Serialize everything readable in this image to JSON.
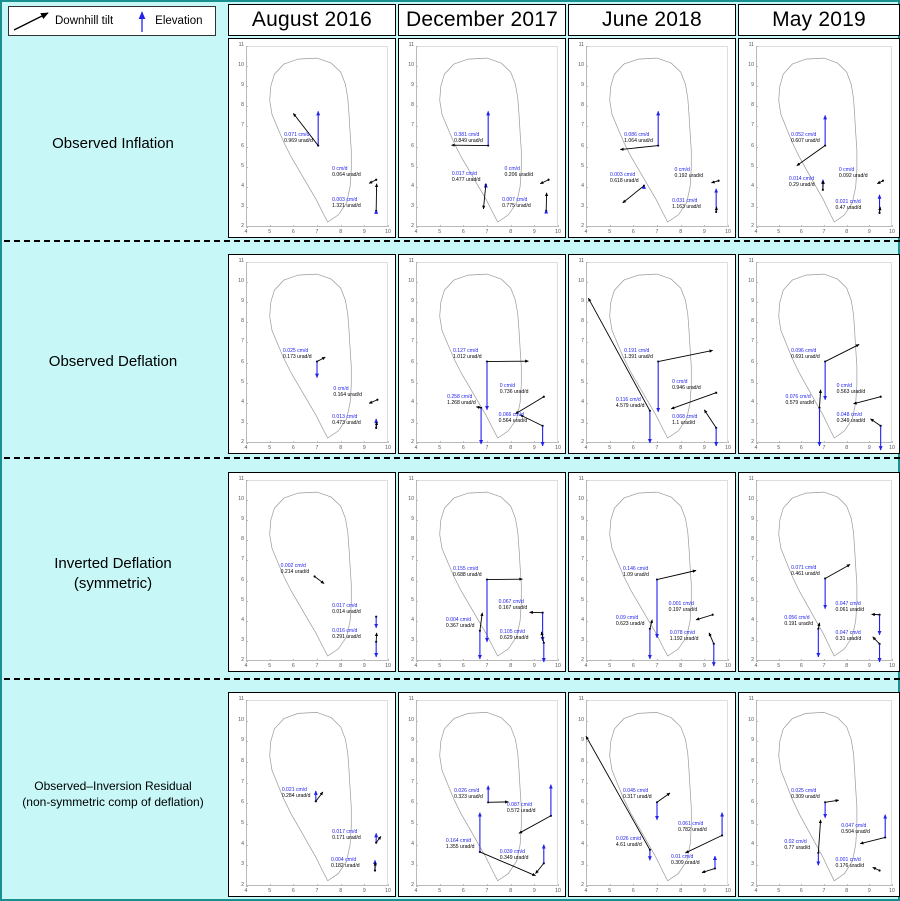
{
  "legend": {
    "tilt_label": "Downhill tilt",
    "elevation_label": "Elevation",
    "tilt_icon": "diagonal-arrow-icon",
    "elevation_icon": "up-arrow-icon",
    "tilt_color": "#000000",
    "elevation_color": "#2222ee"
  },
  "colors": {
    "background": "#c7f7f7",
    "panel": "#ffffff",
    "elevation": "#2222ee",
    "tilt": "#000000",
    "coastline": "#9a9a9a",
    "border": "#1a8f8f"
  },
  "columns": [
    {
      "label": "August 2016"
    },
    {
      "label": "December 2017"
    },
    {
      "label": "June 2018"
    },
    {
      "label": "May 2019"
    }
  ],
  "rows": [
    {
      "line1": "Observed Inflation",
      "line2": ""
    },
    {
      "line1": "Observed Deflation",
      "line2": ""
    },
    {
      "line1": "Inverted Deflation",
      "line2": "(symmetric)"
    },
    {
      "line1": "Observed–Inversion Residual",
      "line2": "(non-symmetric comp of deflation)"
    }
  ],
  "axes": {
    "x_ticks": [
      "4",
      "5",
      "6",
      "7",
      "8",
      "9",
      "10"
    ],
    "y_ticks": [
      "2",
      "3",
      "4",
      "5",
      "6",
      "7",
      "8",
      "9",
      "10",
      "11"
    ],
    "xlim": [
      4,
      10
    ],
    "ylim": [
      2,
      11
    ],
    "units_elevation": "cm/d",
    "units_tilt": "urad/d"
  },
  "chart_data": {
    "type": "scatter",
    "title": "",
    "xlabel": "",
    "ylabel": "",
    "xlim": [
      4,
      10
    ],
    "ylim": [
      2,
      11
    ],
    "grid": false,
    "legend_position": "top-left",
    "series_note": "Each panel shows GPS/tilt station vectors: blue vertical arrow = elevation rate (cm/d), black arrow = downhill tilt direction (urad/d).",
    "panels": [
      {
        "row": "Observed Inflation",
        "column": "August 2016",
        "stations": [
          {
            "x": 7.05,
            "y": 6.05,
            "elevation": "0.071 cm/d",
            "tilt": "0.969 urad/d",
            "elev_dy": 1.7,
            "tilt_dx": -1.05,
            "tilt_dy": 1.6
          },
          {
            "x": 9.5,
            "y": 4.35,
            "elevation": "0 cm/d",
            "tilt": "0.064 urad/d",
            "elev_dy": 0.0,
            "tilt_dx": -0.3,
            "tilt_dy": -0.18
          },
          {
            "x": 9.5,
            "y": 2.8,
            "elevation": "0.003 cm/d",
            "tilt": "1.321 urad/d",
            "elev_dy": 0.05,
            "tilt_dx": 0.02,
            "tilt_dy": 1.35
          }
        ]
      },
      {
        "row": "Observed Inflation",
        "column": "December 2017",
        "stations": [
          {
            "x": 7.05,
            "y": 6.05,
            "elevation": "0.381 cm/d",
            "tilt": "0.849 urad/d",
            "elev_dy": 1.7,
            "tilt_dx": -1.55,
            "tilt_dy": 0.02
          },
          {
            "x": 9.6,
            "y": 4.35,
            "elevation": "0 cm/d",
            "tilt": "0.206 urad/d",
            "elev_dy": 0.0,
            "tilt_dx": -0.35,
            "tilt_dy": -0.2
          },
          {
            "x": 6.95,
            "y": 4.1,
            "elevation": "0.017 cm/d",
            "tilt": "0.477 urad/d",
            "elev_dy": 0.06,
            "tilt_dx": -0.1,
            "tilt_dy": -1.2
          },
          {
            "x": 9.5,
            "y": 2.8,
            "elevation": "0.007 cm/d",
            "tilt": "0.775 urad/d",
            "elev_dy": 0.06,
            "tilt_dx": 0.02,
            "tilt_dy": 0.9
          }
        ]
      },
      {
        "row": "Observed Inflation",
        "column": "June 2018",
        "stations": [
          {
            "x": 7.05,
            "y": 6.05,
            "elevation": "0.086 cm/d",
            "tilt": "1.064 urad/d",
            "elev_dy": 1.7,
            "tilt_dx": -1.6,
            "tilt_dy": -0.2
          },
          {
            "x": 9.6,
            "y": 4.3,
            "elevation": "0 cm/d",
            "tilt": "0.192 urad/d",
            "elev_dy": 0.0,
            "tilt_dx": -0.3,
            "tilt_dy": -0.1
          },
          {
            "x": 6.45,
            "y": 4.05,
            "elevation": "0.003 cm/d",
            "tilt": "0.618 urad/d",
            "elev_dy": 0.04,
            "tilt_dx": -0.9,
            "tilt_dy": -0.85
          },
          {
            "x": 9.5,
            "y": 2.75,
            "elevation": "0.031 cm/d",
            "tilt": "1.163 urad/d",
            "elev_dy": 1.15,
            "tilt_dx": 0.02,
            "tilt_dy": 0.25
          }
        ]
      },
      {
        "row": "Observed Inflation",
        "column": "May 2019",
        "stations": [
          {
            "x": 7.05,
            "y": 6.05,
            "elevation": "0.052 cm/d",
            "tilt": "0.607 urad/d",
            "elev_dy": 1.5,
            "tilt_dx": -1.25,
            "tilt_dy": -1.0
          },
          {
            "x": 9.6,
            "y": 4.3,
            "elevation": "0 cm/d",
            "tilt": "0.092 urad/d",
            "elev_dy": 0.0,
            "tilt_dx": -0.25,
            "tilt_dy": -0.15
          },
          {
            "x": 6.95,
            "y": 3.85,
            "elevation": "0.014 cm/d",
            "tilt": "0.29 urad/d",
            "elev_dy": 0.5,
            "tilt_dx": 0.02,
            "tilt_dy": 0.45
          },
          {
            "x": 9.45,
            "y": 2.7,
            "elevation": "0.021 cm/d",
            "tilt": "0.47 urad/d",
            "elev_dy": 0.9,
            "tilt_dx": 0.03,
            "tilt_dy": 0.3
          }
        ]
      },
      {
        "row": "Observed Deflation",
        "column": "August 2016",
        "stations": [
          {
            "x": 7.0,
            "y": 6.05,
            "elevation": "0.025 cm/d",
            "tilt": "0.173 urad/d",
            "elev_dy": -0.8,
            "tilt_dx": 0.35,
            "tilt_dy": 0.22
          },
          {
            "x": 9.55,
            "y": 4.15,
            "elevation": "0 cm/d",
            "tilt": "0.164 urad/d",
            "elev_dy": 0.0,
            "tilt_dx": -0.35,
            "tilt_dy": -0.18
          },
          {
            "x": 9.5,
            "y": 2.75,
            "elevation": "0.013 cm/d",
            "tilt": "0.473 urad/d",
            "elev_dy": 0.45,
            "tilt_dx": 0.03,
            "tilt_dy": 0.3
          }
        ]
      },
      {
        "row": "Observed Deflation",
        "column": "December 2017",
        "stations": [
          {
            "x": 7.0,
            "y": 6.05,
            "elevation": "0.127 cm/d",
            "tilt": "1.012 urad/d",
            "elev_dy": -2.4,
            "tilt_dx": 1.75,
            "tilt_dy": 0.02
          },
          {
            "x": 9.4,
            "y": 4.3,
            "elevation": "0 cm/d",
            "tilt": "0.736 urad/d",
            "elev_dy": 0.0,
            "tilt_dx": -1.2,
            "tilt_dy": -0.85
          },
          {
            "x": 6.75,
            "y": 3.75,
            "elevation": "0.258 cm/d",
            "tilt": "1.268 urad/d",
            "elev_dy": -1.8,
            "tilt_dx": -0.2,
            "tilt_dy": 0.05
          },
          {
            "x": 9.35,
            "y": 2.85,
            "elevation": "0.066 cm/d",
            "tilt": "0.564 urad/d",
            "elev_dy": -1.0,
            "tilt_dx": -0.95,
            "tilt_dy": 0.55
          }
        ]
      },
      {
        "row": "Observed Deflation",
        "column": "June 2018",
        "stations": [
          {
            "x": 7.05,
            "y": 6.05,
            "elevation": "0.191 cm/d",
            "tilt": "1.391 urad/d",
            "elev_dy": -2.5,
            "tilt_dx": 2.3,
            "tilt_dy": 0.55
          },
          {
            "x": 9.5,
            "y": 4.5,
            "elevation": "0 cm/d",
            "tilt": "0.946 urad/d",
            "elev_dy": 0.0,
            "tilt_dx": -1.9,
            "tilt_dy": -0.8
          },
          {
            "x": 6.7,
            "y": 3.6,
            "elevation": "0.116 cm/d",
            "tilt": "4.579 urad/d",
            "elev_dy": -1.6,
            "tilt_dx": -2.6,
            "tilt_dy": 5.6
          },
          {
            "x": 9.5,
            "y": 2.75,
            "elevation": "0.068 cm/d",
            "tilt": "1.1 urad/d",
            "elev_dy": -0.9,
            "tilt_dx": -0.5,
            "tilt_dy": 0.9
          }
        ]
      },
      {
        "row": "Observed Deflation",
        "column": "May 2019",
        "stations": [
          {
            "x": 7.05,
            "y": 6.05,
            "elevation": "0.096 cm/d",
            "tilt": "0.691 urad/d",
            "elev_dy": -1.9,
            "tilt_dx": 1.5,
            "tilt_dy": 0.85
          },
          {
            "x": 9.5,
            "y": 4.3,
            "elevation": "0 cm/d",
            "tilt": "0.563 urad/d",
            "elev_dy": 0.0,
            "tilt_dx": -1.2,
            "tilt_dy": -0.35
          },
          {
            "x": 6.8,
            "y": 3.75,
            "elevation": "0.076 cm/d",
            "tilt": "0.579 urad/d",
            "elev_dy": -1.9,
            "tilt_dx": 0.05,
            "tilt_dy": 0.9
          },
          {
            "x": 9.5,
            "y": 2.85,
            "elevation": "0.048 cm/d",
            "tilt": "0.349 urad/d",
            "elev_dy": -1.2,
            "tilt_dx": -0.45,
            "tilt_dy": 0.35
          }
        ]
      },
      {
        "row": "Inverted Deflation",
        "column": "August 2016",
        "stations": [
          {
            "x": 6.9,
            "y": 6.2,
            "elevation": "0.002 cm/d",
            "tilt": "0.214 urad/d",
            "elev_dy": 0.0,
            "tilt_dx": 0.4,
            "tilt_dy": -0.35
          },
          {
            "x": 9.5,
            "y": 4.2,
            "elevation": "0.017 cm/d",
            "tilt": "0.014 urad/d",
            "elev_dy": -0.55,
            "tilt_dx": 0.0,
            "tilt_dy": 0.0
          },
          {
            "x": 9.5,
            "y": 2.95,
            "elevation": "0.016 cm/d",
            "tilt": "0.291 urad/d",
            "elev_dy": -0.75,
            "tilt_dx": 0.02,
            "tilt_dy": 0.45
          }
        ]
      },
      {
        "row": "Inverted Deflation",
        "column": "December 2017",
        "stations": [
          {
            "x": 7.0,
            "y": 6.05,
            "elevation": "0.155 cm/d",
            "tilt": "0.688 urad/d",
            "elev_dy": -3.1,
            "tilt_dx": 1.5,
            "tilt_dy": 0.02
          },
          {
            "x": 9.35,
            "y": 4.4,
            "elevation": "0.067 cm/d",
            "tilt": "0.167 urad/d",
            "elev_dy": -1.4,
            "tilt_dx": -0.55,
            "tilt_dy": 0.02
          },
          {
            "x": 6.7,
            "y": 3.5,
            "elevation": "0.004 cm/d",
            "tilt": "0.367 urad/d",
            "elev_dy": -1.4,
            "tilt_dx": 0.1,
            "tilt_dy": 0.9
          },
          {
            "x": 9.4,
            "y": 2.9,
            "elevation": "0.105 cm/d",
            "tilt": "0.629 urad/d",
            "elev_dy": -0.95,
            "tilt_dx": -0.1,
            "tilt_dy": 0.55
          }
        ]
      },
      {
        "row": "Inverted Deflation",
        "column": "June 2018",
        "stations": [
          {
            "x": 7.0,
            "y": 6.05,
            "elevation": "0.146 cm/d",
            "tilt": "1.09 urad/d",
            "elev_dy": -2.9,
            "tilt_dx": 1.65,
            "tilt_dy": 0.45
          },
          {
            "x": 9.35,
            "y": 4.3,
            "elevation": "0.001 cm/d",
            "tilt": "0.197 urad/d",
            "elev_dy": 0.0,
            "tilt_dx": -0.7,
            "tilt_dy": -0.25
          },
          {
            "x": 6.7,
            "y": 3.6,
            "elevation": "0.09 cm/d",
            "tilt": "0.623 urad/d",
            "elev_dy": -1.5,
            "tilt_dx": 0.1,
            "tilt_dy": 0.45
          },
          {
            "x": 9.4,
            "y": 2.85,
            "elevation": "0.078 cm/d",
            "tilt": "1.192 urad/d",
            "elev_dy": -1.1,
            "tilt_dx": -0.2,
            "tilt_dy": 0.55
          }
        ]
      },
      {
        "row": "Inverted Deflation",
        "column": "May 2019",
        "stations": [
          {
            "x": 7.05,
            "y": 6.1,
            "elevation": "0.071 cm/d",
            "tilt": "0.461 urad/d",
            "elev_dy": -1.5,
            "tilt_dx": 1.1,
            "tilt_dy": 0.7
          },
          {
            "x": 9.45,
            "y": 4.3,
            "elevation": "0.047 cm/d",
            "tilt": "0.061 urad/d",
            "elev_dy": -1.0,
            "tilt_dx": -0.35,
            "tilt_dy": 0.02
          },
          {
            "x": 6.75,
            "y": 3.6,
            "elevation": "0.056 cm/d",
            "tilt": "0.191 urad/d",
            "elev_dy": -1.4,
            "tilt_dx": 0.05,
            "tilt_dy": 0.3
          },
          {
            "x": 9.45,
            "y": 2.85,
            "elevation": "0.047 cm/d",
            "tilt": "0.31 urad/d",
            "elev_dy": -0.9,
            "tilt_dx": -0.3,
            "tilt_dy": 0.35
          }
        ]
      },
      {
        "row": "Observed–Inversion Residual",
        "column": "August 2016",
        "stations": [
          {
            "x": 6.95,
            "y": 6.1,
            "elevation": "0.021 cm/d",
            "tilt": "0.284 urad/d",
            "elev_dy": 0.5,
            "tilt_dx": 0.3,
            "tilt_dy": 0.45
          },
          {
            "x": 9.5,
            "y": 4.1,
            "elevation": "0.017 cm/d",
            "tilt": "0.171 urad/d",
            "elev_dy": 0.45,
            "tilt_dx": 0.2,
            "tilt_dy": 0.3
          },
          {
            "x": 9.45,
            "y": 2.75,
            "elevation": "0.004 cm/d",
            "tilt": "0.182 urad/d",
            "elev_dy": 0.5,
            "tilt_dx": 0.02,
            "tilt_dy": 0.4
          }
        ]
      },
      {
        "row": "Observed–Inversion Residual",
        "column": "December 2017",
        "stations": [
          {
            "x": 7.05,
            "y": 6.05,
            "elevation": "0.026 cm/d",
            "tilt": "0.323 urad/d",
            "elev_dy": 0.8,
            "tilt_dx": 0.85,
            "tilt_dy": 0.02
          },
          {
            "x": 9.7,
            "y": 5.4,
            "elevation": "0.087 cm/d",
            "tilt": "0.572 urad/d",
            "elev_dy": 1.5,
            "tilt_dx": -1.35,
            "tilt_dy": -0.85
          },
          {
            "x": 6.7,
            "y": 3.65,
            "elevation": "0.164 cm/d",
            "tilt": "1.355 urad/d",
            "elev_dy": 1.9,
            "tilt_dx": 2.35,
            "tilt_dy": -1.15
          },
          {
            "x": 9.4,
            "y": 3.1,
            "elevation": "0.039 cm/d",
            "tilt": "0.349 urad/d",
            "elev_dy": 0.9,
            "tilt_dx": -0.35,
            "tilt_dy": -0.5
          }
        ]
      },
      {
        "row": "Observed–Inversion Residual",
        "column": "June 2018",
        "stations": [
          {
            "x": 7.0,
            "y": 6.05,
            "elevation": "0.045 cm/d",
            "tilt": "0.317 urad/d",
            "elev_dy": -0.85,
            "tilt_dx": 0.55,
            "tilt_dy": 0.45
          },
          {
            "x": 9.75,
            "y": 4.45,
            "elevation": "0.061 cm/d",
            "tilt": "0.782 urad/d",
            "elev_dy": 1.1,
            "tilt_dx": -1.55,
            "tilt_dy": -0.85
          },
          {
            "x": 6.7,
            "y": 3.75,
            "elevation": "0.026 cm/d",
            "tilt": "4.61 urad/d",
            "elev_dy": -0.5,
            "tilt_dx": -2.7,
            "tilt_dy": 5.5
          },
          {
            "x": 9.45,
            "y": 2.85,
            "elevation": "0.01 cm/d",
            "tilt": "0.309 urad/d",
            "elev_dy": 0.6,
            "tilt_dx": -0.55,
            "tilt_dy": -0.2
          }
        ]
      },
      {
        "row": "Observed–Inversion Residual",
        "column": "May 2019",
        "stations": [
          {
            "x": 7.05,
            "y": 6.05,
            "elevation": "0.025 cm/d",
            "tilt": "0.309 urad/d",
            "elev_dy": -0.75,
            "tilt_dx": 0.6,
            "tilt_dy": 0.1
          },
          {
            "x": 9.7,
            "y": 4.35,
            "elevation": "0.047 cm/d",
            "tilt": "0.504 urad/d",
            "elev_dy": 1.1,
            "tilt_dx": -1.1,
            "tilt_dy": -0.3
          },
          {
            "x": 6.75,
            "y": 3.6,
            "elevation": "0.02 cm/d",
            "tilt": "0.77 urad/d",
            "elev_dy": -0.6,
            "tilt_dx": 0.1,
            "tilt_dy": 1.6
          },
          {
            "x": 9.45,
            "y": 2.75,
            "elevation": "0.001 cm/d",
            "tilt": "0.176 urad/d",
            "elev_dy": 0.0,
            "tilt_dx": -0.3,
            "tilt_dy": 0.15
          }
        ]
      }
    ]
  }
}
